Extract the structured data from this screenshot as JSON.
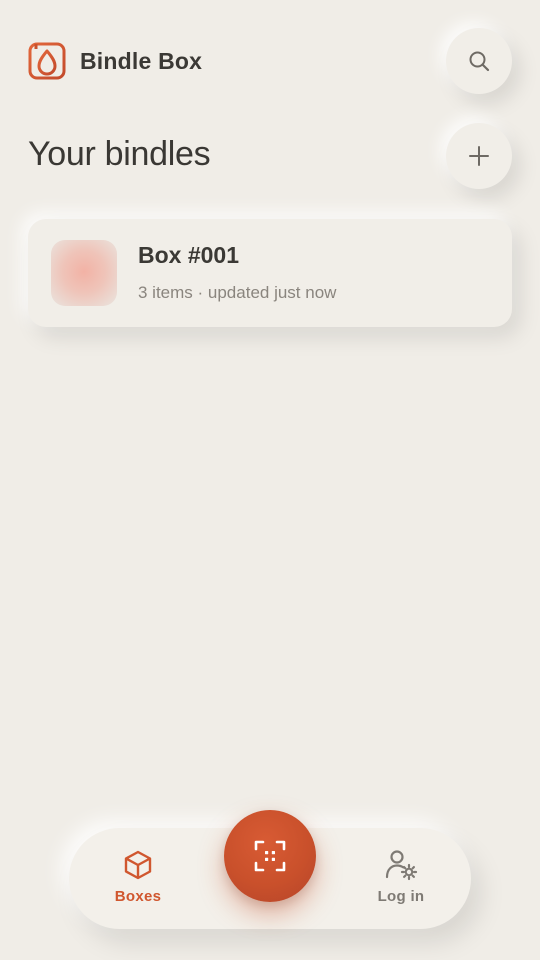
{
  "header": {
    "app_title": "Bindle Box",
    "logo_icon": "bindle-logo-icon",
    "search_icon": "search-icon"
  },
  "section": {
    "title": "Your bindles",
    "add_icon": "plus-icon"
  },
  "boxes": [
    {
      "title": "Box #001",
      "subtitle": "3 items · updated just now"
    }
  ],
  "nav": {
    "items": [
      {
        "label": "Boxes",
        "icon": "box-icon",
        "active": true
      },
      {
        "label": "Log in",
        "icon": "user-settings-icon",
        "active": false
      }
    ],
    "center_action_icon": "scan-icon"
  },
  "colors": {
    "background": "#f0ede7",
    "accent": "#d0572f",
    "text_primary": "#3b3935",
    "text_secondary": "#8a857e"
  }
}
